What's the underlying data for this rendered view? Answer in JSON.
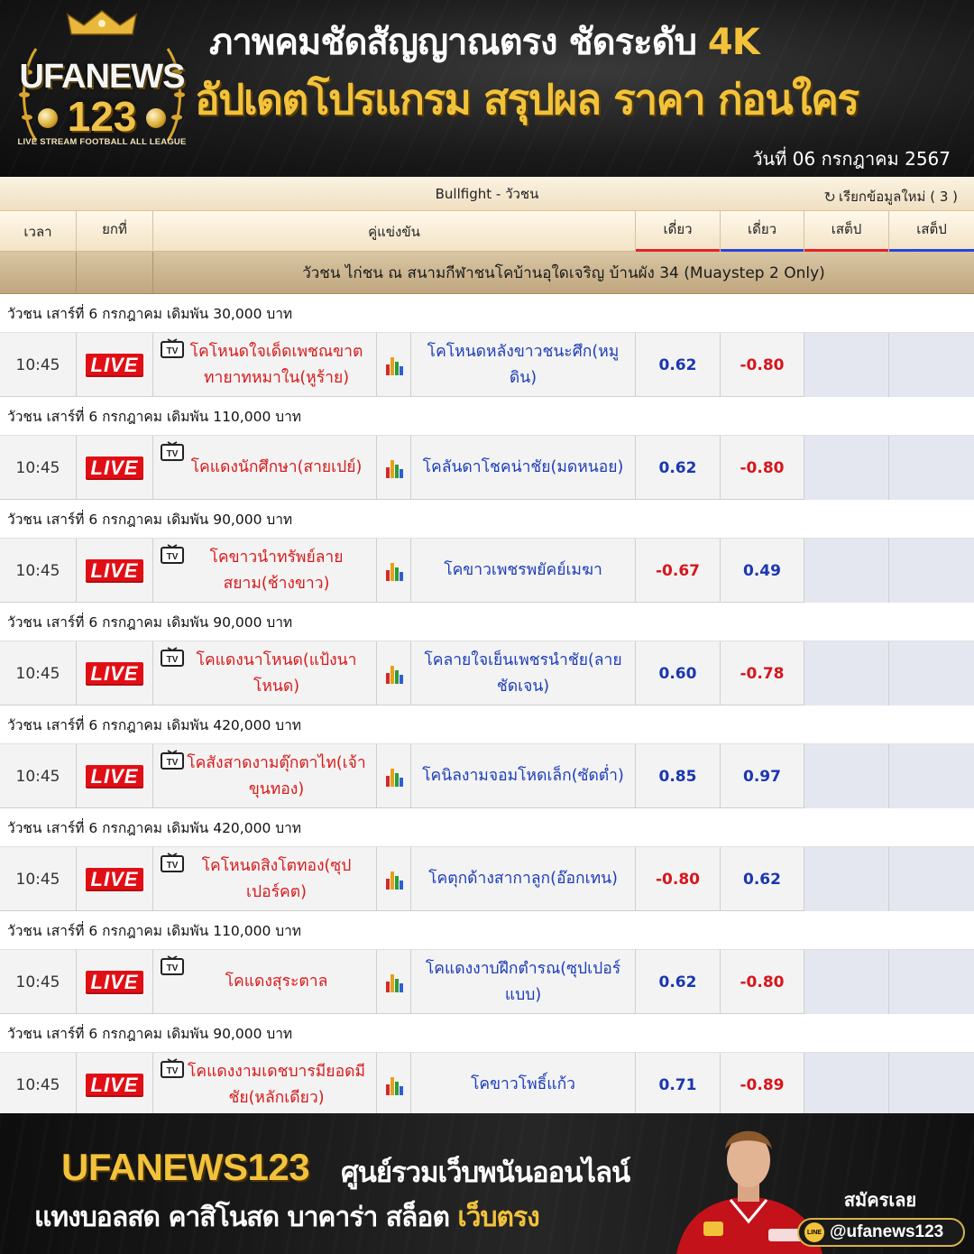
{
  "header": {
    "logo": {
      "brand": "UFANEWS",
      "number": "123",
      "tagline": "LIVE STREAM FOOTBALL ALL LEAGUE"
    },
    "headline1": "ภาพคมชัดสัญญาณตรง ชัดระดับ",
    "headline1_accent": "4K",
    "headline2": "อัปเดตโปรแกรม สรุปผล ราคา ก่อนใคร",
    "date": "วันที่ 06 กรกฎาคม 2567"
  },
  "board": {
    "title": "Bullfight - วัวชน",
    "refresh_label": "เรียกข้อมูลใหม่ ( 3 )",
    "columns": [
      "เวลา",
      "ยกที่",
      "คู่แข่งขัน",
      "เดี่ยว",
      "เดี่ยว",
      "เสต็ป",
      "เสต็ป"
    ],
    "column_bar_colors": [
      "#e0242b",
      "#2b45d8",
      "#e0242b",
      "#2b45d8"
    ],
    "venue": "วัวชน ไก่ชน ณ สนามกีฬาชนโคบ้านอุใดเจริญ บ้านผัง 34 (Muaystep 2 Only)",
    "live_label": "LIVE",
    "matches": [
      {
        "group": "วัวชน เสาร์ที่ 6 กรกฎาคม เดิมพัน 30,000 บาท",
        "time": "10:45",
        "home": "โคโหนดใจเด็ดเพชณขาตทายาทหมาใน(หูร้าย)",
        "away": "โคโหนดหลังขาวชนะศึก(หมูดิน)",
        "odd1": "0.62",
        "odd2": "-0.80"
      },
      {
        "group": "วัวชน เสาร์ที่ 6 กรกฎาคม เดิมพัน 110,000 บาท",
        "time": "10:45",
        "home": "โคแดงนักศึกษา(สายเปย์)",
        "away": "โคลันดาโชคน่าชัย(มดหนอย)",
        "odd1": "0.62",
        "odd2": "-0.80"
      },
      {
        "group": "วัวชน เสาร์ที่ 6 กรกฎาคม เดิมพัน 90,000 บาท",
        "time": "10:45",
        "home": "โคขาวนำทรัพย์ลายสยาม(ช้างขาว)",
        "away": "โคขาวเพชรพยัคย์เมฆา",
        "odd1": "-0.67",
        "odd2": "0.49"
      },
      {
        "group": "วัวชน เสาร์ที่ 6 กรกฎาคม เดิมพัน 90,000 บาท",
        "time": "10:45",
        "home": "โคแดงนาโหนด(แป้งนาโหนด)",
        "away": "โคลายใจเย็นเพชรนำชัย(ลายชัดเจน)",
        "odd1": "0.60",
        "odd2": "-0.78"
      },
      {
        "group": "วัวชน เสาร์ที่ 6 กรกฎาคม เดิมพัน 420,000 บาท",
        "time": "10:45",
        "home": "โคสังสาดงามตุ๊กตาไท(เจ้าขุนทอง)",
        "away": "โคนิลงามจอมโหดเล็ก(ซัดต่ำ)",
        "odd1": "0.85",
        "odd2": "0.97"
      },
      {
        "group": "วัวชน เสาร์ที่ 6 กรกฎาคม เดิมพัน 420,000 บาท",
        "time": "10:45",
        "home": "โคโหนดสิงโตทอง(ซุปเปอร์คต)",
        "away": "โคตุกด้างสากาลูก(อ๊อกเทน)",
        "odd1": "-0.80",
        "odd2": "0.62"
      },
      {
        "group": "วัวชน เสาร์ที่ 6 กรกฎาคม เดิมพัน 110,000 บาท",
        "time": "10:45",
        "home": "โคแดงสุระตาล",
        "away": "โคแดงงาบฝึกตำรณ(ซุปเปอร์แบบ)",
        "odd1": "0.62",
        "odd2": "-0.80"
      },
      {
        "group": "วัวชน เสาร์ที่ 6 กรกฎาคม เดิมพัน 90,000 บาท",
        "time": "10:45",
        "home": "โคแดงงามเดชบารมียอดมีชัย(หลักเดียว)",
        "away": "โคขาวโพธิ์แก้ว",
        "odd1": "0.71",
        "odd2": "-0.89"
      }
    ]
  },
  "footer": {
    "brand": "UFANEWS123",
    "line1": "ศูนย์รวมเว็บพนันออนไลน์",
    "line2": "แทงบอลสด คาสิโนสด บาคาร่า สล็อต",
    "line2_accent": "เว็บตรง",
    "signup": "สมัครเลย",
    "line_badge": "LINE",
    "line_id": "@ufanews123"
  }
}
